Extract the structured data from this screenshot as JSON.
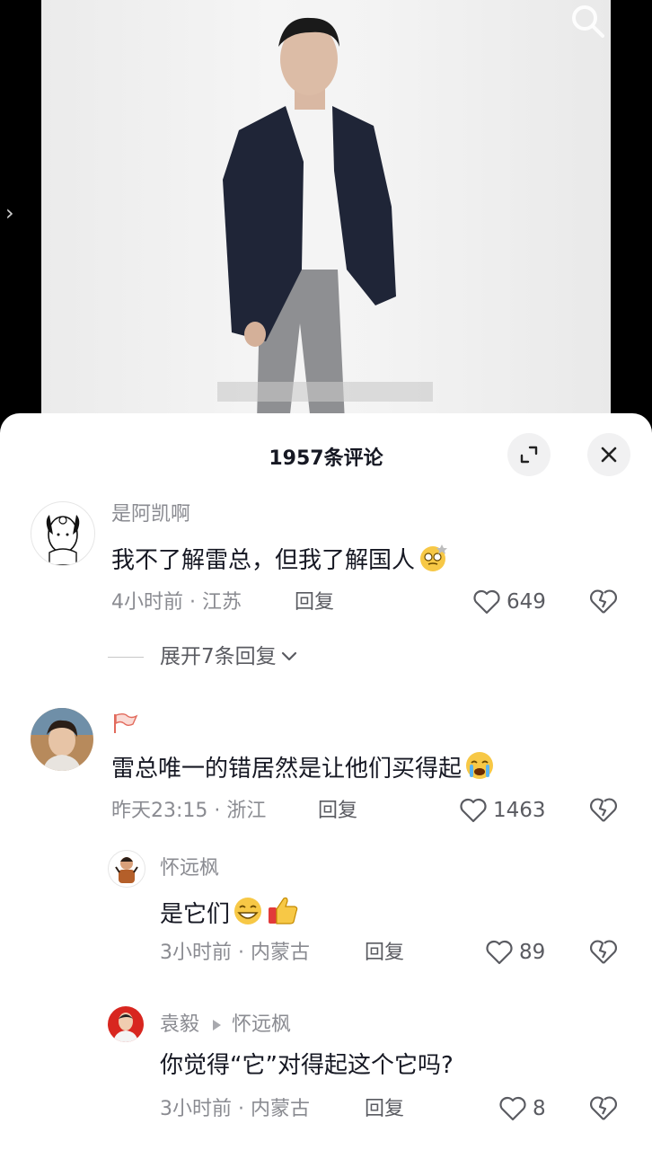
{
  "panel": {
    "title": "1957条评论"
  },
  "comments": [
    {
      "username": "是阿凯啊",
      "text": "我不了解雷总，但我了解国人",
      "emoji": "dizzy-face-emoji",
      "meta": "4小时前 · 江苏",
      "reply_label": "回复",
      "likes": "649",
      "expand_label": "展开7条回复"
    },
    {
      "username": "",
      "badge_icon": "flag-icon",
      "text": "雷总唯一的错居然是让他们买得起",
      "emoji": "crying-face-emoji",
      "meta": "昨天23:15 · 浙江",
      "reply_label": "回复",
      "likes": "1463"
    }
  ],
  "replies": [
    {
      "username": "怀远枫",
      "text": "是它们",
      "emoji": "grinning-face-emoji, thumbs-up-emoji",
      "meta": "3小时前 · 内蒙古",
      "reply_label": "回复",
      "likes": "89"
    },
    {
      "username": "袁毅",
      "reply_to": "怀远枫",
      "text": "你觉得“它”对得起这个它吗?",
      "meta": "3小时前 · 内蒙古",
      "reply_label": "回复",
      "likes": "8"
    }
  ],
  "colors": {
    "text_primary": "#161823",
    "text_secondary": "#8a8b91",
    "panel_bg": "#ffffff",
    "button_bg": "#f1f1f2"
  }
}
